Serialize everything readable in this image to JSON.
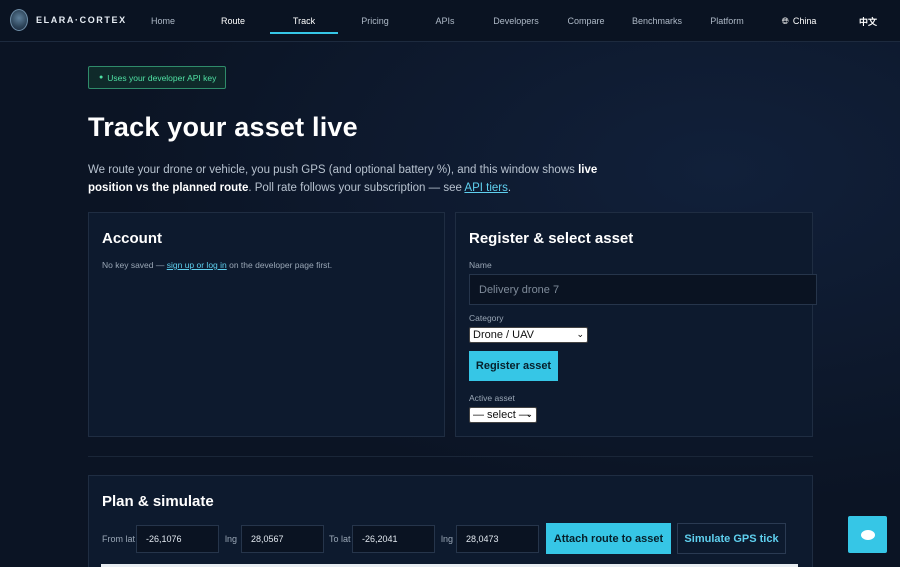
{
  "nav": {
    "brand": "ELARA·CORTEX",
    "items": [
      {
        "label": "Home"
      },
      {
        "label": "Route"
      },
      {
        "label": "Track"
      },
      {
        "label": "Pricing"
      },
      {
        "label": "APIs"
      },
      {
        "label": "Developers"
      },
      {
        "label": "Compare"
      },
      {
        "label": "Benchmarks"
      },
      {
        "label": "Platform"
      }
    ],
    "region": "China",
    "language": "中文"
  },
  "badge": "Uses your developer API key",
  "page_title": "Track your asset live",
  "intro": {
    "part1": "We route your drone or vehicle, you push GPS (and optional battery %), and this window shows ",
    "bold": "live position vs the planned route",
    "part2": ". Poll rate follows your subscription — see ",
    "link": "API tiers",
    "part3": "."
  },
  "account": {
    "title": "Account",
    "note_prefix": "No key saved — ",
    "note_link": "sign up or log in",
    "note_suffix": " on the developer page first."
  },
  "register": {
    "title": "Register & select asset",
    "name_label": "Name",
    "name_placeholder": "Delivery drone 7",
    "category_label": "Category",
    "category_value": "Drone / UAV",
    "register_button": "Register asset",
    "active_label": "Active asset",
    "active_value": "— select —"
  },
  "plan": {
    "title": "Plan & simulate",
    "from_lat_label": "From lat",
    "from_lat": "-26,1076",
    "from_lng_label": "lng",
    "from_lng": "28,0567",
    "to_lat_label": "To lat",
    "to_lat": "-26,2041",
    "to_lng_label": "lng",
    "to_lng": "28,0473",
    "attach_button": "Attach route to asset",
    "simulate_button": "Simulate GPS tick"
  }
}
